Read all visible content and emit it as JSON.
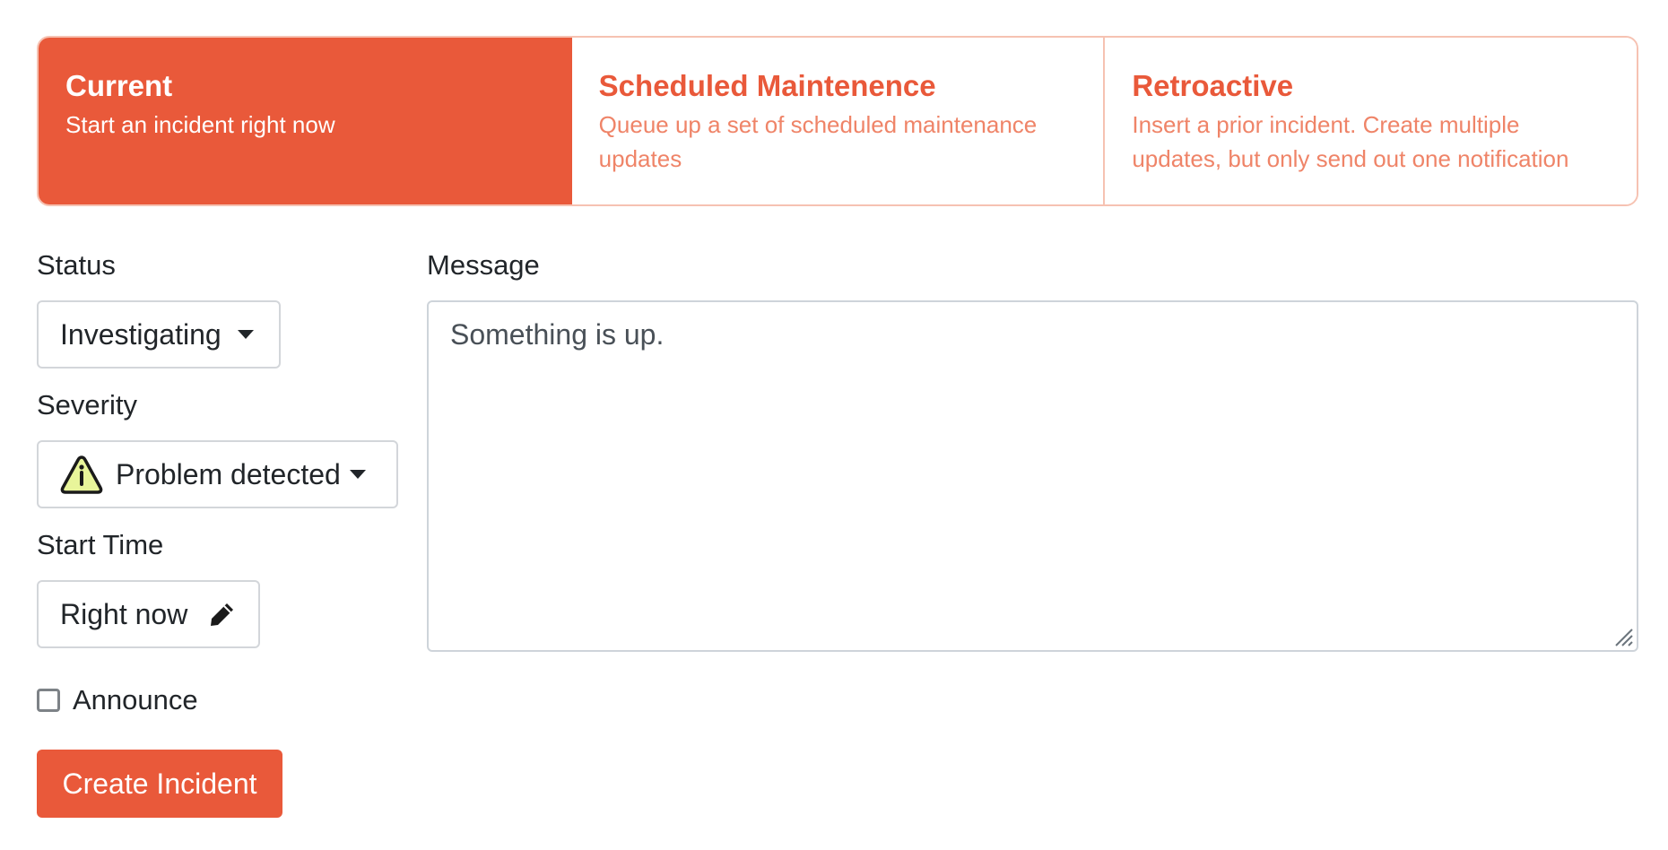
{
  "tabs": [
    {
      "title": "Current",
      "description": "Start an incident right now",
      "active": true
    },
    {
      "title": "Scheduled Maintenence",
      "description": "Queue up a set of scheduled maintenance updates",
      "active": false
    },
    {
      "title": "Retroactive",
      "description": "Insert a prior incident. Create multiple updates, but only send out one notification",
      "active": false
    }
  ],
  "form": {
    "status_label": "Status",
    "status_value": "Investigating",
    "severity_label": "Severity",
    "severity_value": "Problem detected",
    "severity_icon": "warning-triangle-icon",
    "start_time_label": "Start Time",
    "start_time_value": "Right now",
    "start_time_icon": "pencil-icon",
    "message_label": "Message",
    "message_value": "Something is up.",
    "announce_label": "Announce",
    "announce_checked": false,
    "submit_label": "Create Incident"
  },
  "colors": {
    "accent": "#e9593a",
    "accent_light": "#ef8468",
    "tab_border": "#f6c2b2",
    "warning_fill": "#e8f59a"
  }
}
